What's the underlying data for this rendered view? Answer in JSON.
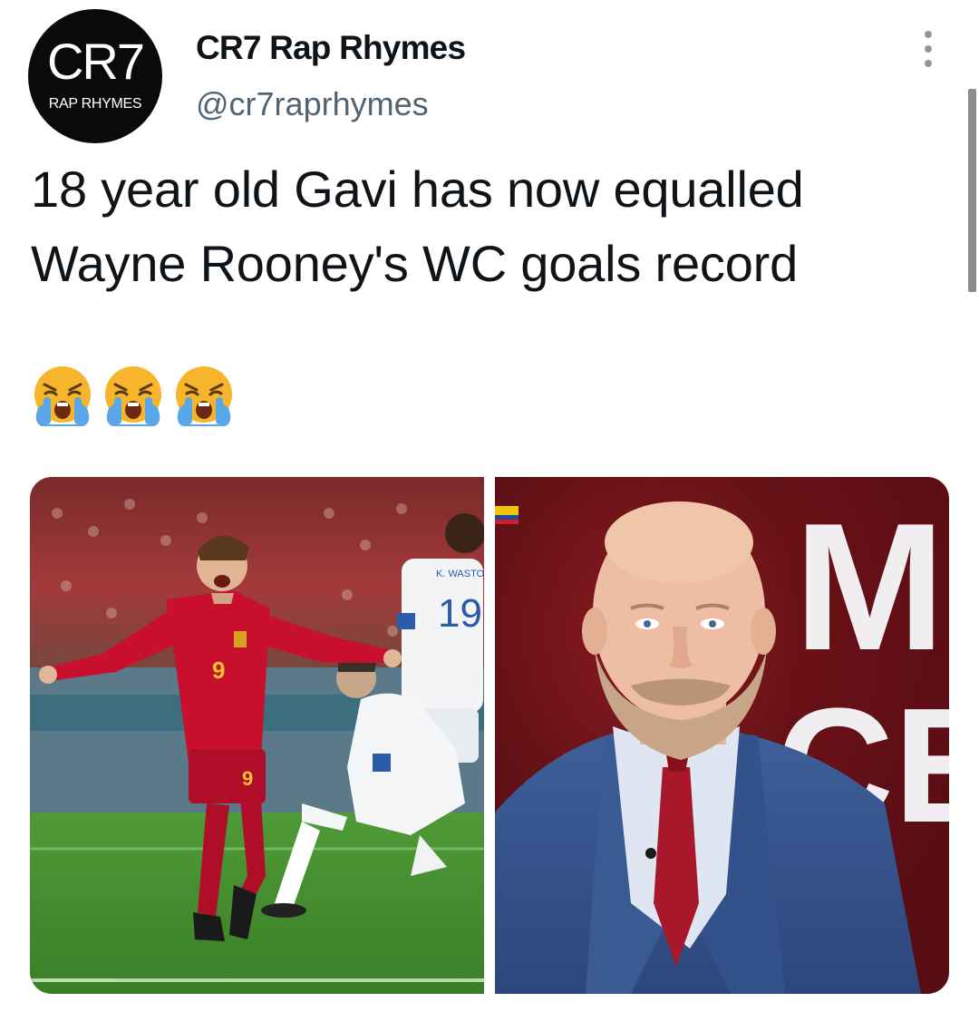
{
  "author": {
    "avatar_logo": "CR7",
    "avatar_subtitle": "RAP RHYMES",
    "display_name": "CR7 Rap Rhymes",
    "handle": "@cr7raprhymes"
  },
  "tweet": {
    "text_lines": [
      "18 year old Gavi has now equalled",
      "Wayne Rooney's WC goals record"
    ],
    "emoji_name": "loudly-crying-face",
    "emoji_count": 3
  },
  "media": {
    "left_photo": {
      "player_number": "9",
      "opponent_number": "19",
      "opponent_name": "K. WASTON"
    },
    "right_photo": {
      "backdrop_letters": [
        "M",
        "CE"
      ]
    }
  },
  "colors": {
    "text": "#0f1419",
    "secondary": "#536471",
    "spain_red": "#c8102e",
    "pitch_green": "#3f8a2e",
    "studio_red": "#5a0e14"
  }
}
